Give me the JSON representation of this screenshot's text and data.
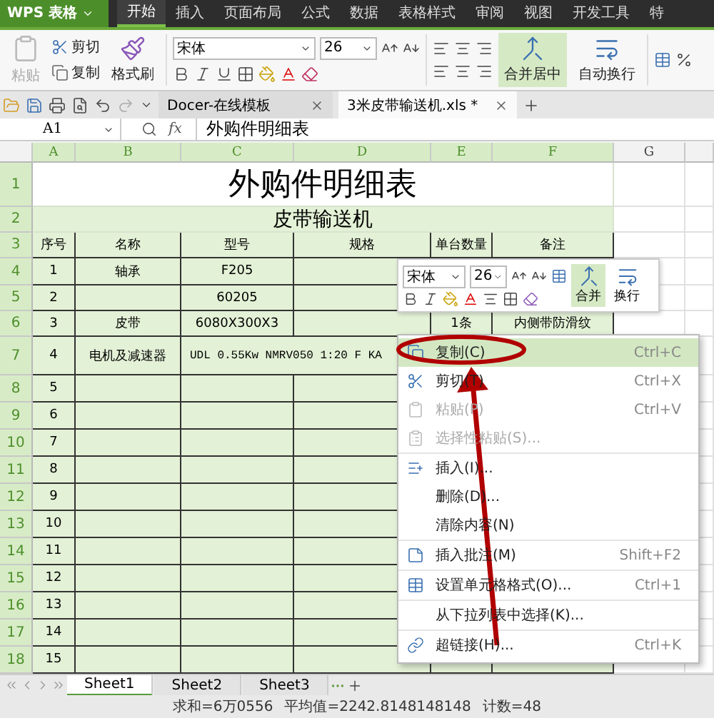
{
  "app": {
    "title": "WPS 表格"
  },
  "menu_tabs": [
    {
      "label": "开始",
      "selected": true
    },
    {
      "label": "插入",
      "selected": false
    },
    {
      "label": "页面布局",
      "selected": false
    },
    {
      "label": "公式",
      "selected": false
    },
    {
      "label": "数据",
      "selected": false
    },
    {
      "label": "表格样式",
      "selected": false
    },
    {
      "label": "审阅",
      "selected": false
    },
    {
      "label": "视图",
      "selected": false
    },
    {
      "label": "开发工具",
      "selected": false
    },
    {
      "label": "特",
      "selected": false
    }
  ],
  "ribbon": {
    "paste": {
      "label": "粘贴",
      "disabled": true
    },
    "cut": "剪切",
    "copy": "复制",
    "format_painter": "格式刷",
    "font": "宋体",
    "font_size": "26",
    "merge": {
      "label": "合并居中",
      "selected": true
    },
    "wrap": "自动换行"
  },
  "doc_tabs": [
    {
      "label": "Docer-在线模板",
      "selected": false
    },
    {
      "label": "3米皮带输送机.xls *",
      "selected": true
    }
  ],
  "formula_bar": {
    "name_box": "A1",
    "fx": "fx",
    "value": "外购件明细表"
  },
  "columns": [
    {
      "label": "A",
      "selected": true
    },
    {
      "label": "B",
      "selected": true
    },
    {
      "label": "C",
      "selected": true
    },
    {
      "label": "D",
      "selected": true
    },
    {
      "label": "E",
      "selected": true
    },
    {
      "label": "F",
      "selected": true
    },
    {
      "label": "G",
      "selected": false
    }
  ],
  "rows": [
    {
      "number": "1",
      "selected": true,
      "kind": "title",
      "cells": {
        "A": "外购件明细表"
      }
    },
    {
      "number": "2",
      "selected": true,
      "kind": "subtitle",
      "cells": {
        "A": "皮带输送机"
      }
    },
    {
      "number": "3",
      "selected": true,
      "kind": "data",
      "cells": {
        "A": "序号",
        "B": "名称",
        "C": "型号",
        "D": "规格",
        "E": "单台数量",
        "F": "备注"
      }
    },
    {
      "number": "4",
      "selected": true,
      "kind": "data",
      "cells": {
        "A": "1",
        "B": "轴承",
        "C": "F205"
      }
    },
    {
      "number": "5",
      "selected": true,
      "kind": "data",
      "cells": {
        "A": "2",
        "C": "60205"
      }
    },
    {
      "number": "6",
      "selected": true,
      "kind": "data",
      "cells": {
        "A": "3",
        "B": "皮带",
        "C": "6080X300X3",
        "E": "1条",
        "F": "内侧带防滑纹"
      }
    },
    {
      "number": "7",
      "selected": true,
      "kind": "merged",
      "cells": {
        "A": "4",
        "B": "电机及减速器",
        "C": "UDL 0.55Kw NMRV050 1:20 F KA"
      }
    },
    {
      "number": "8",
      "selected": true,
      "kind": "data",
      "cells": {
        "A": "5"
      }
    },
    {
      "number": "9",
      "selected": true,
      "kind": "data",
      "cells": {
        "A": "6"
      }
    },
    {
      "number": "10",
      "selected": true,
      "kind": "data",
      "cells": {
        "A": "7"
      }
    },
    {
      "number": "11",
      "selected": true,
      "kind": "data",
      "cells": {
        "A": "8"
      }
    },
    {
      "number": "12",
      "selected": true,
      "kind": "data",
      "cells": {
        "A": "9"
      }
    },
    {
      "number": "13",
      "selected": true,
      "kind": "data",
      "cells": {
        "A": "10"
      }
    },
    {
      "number": "14",
      "selected": true,
      "kind": "data",
      "cells": {
        "A": "11"
      }
    },
    {
      "number": "15",
      "selected": true,
      "kind": "data",
      "cells": {
        "A": "12"
      }
    },
    {
      "number": "16",
      "selected": true,
      "kind": "data",
      "cells": {
        "A": "13"
      }
    },
    {
      "number": "17",
      "selected": true,
      "kind": "data",
      "cells": {
        "A": "14"
      }
    },
    {
      "number": "18",
      "selected": true,
      "kind": "data",
      "cells": {
        "A": "15"
      }
    }
  ],
  "mini_toolbar": {
    "font": "宋体",
    "size": "26",
    "merge": "合并",
    "wrap": "换行"
  },
  "context_menu": [
    [
      {
        "label": "复制(C)",
        "shortcut": "Ctrl+C",
        "selected": true,
        "disabled": false
      },
      {
        "label": "剪切(T)",
        "shortcut": "Ctrl+X",
        "selected": false,
        "disabled": false
      },
      {
        "label": "粘贴(P)",
        "shortcut": "Ctrl+V",
        "selected": false,
        "disabled": true
      },
      {
        "label": "选择性粘贴(S)...",
        "selected": false,
        "disabled": true
      }
    ],
    [
      {
        "label": "插入(I)...",
        "selected": false,
        "disabled": false
      },
      {
        "label": "删除(D)...",
        "selected": false,
        "disabled": false
      },
      {
        "label": "清除内容(N)",
        "selected": false,
        "disabled": false
      }
    ],
    [
      {
        "label": "插入批注(M)",
        "shortcut": "Shift+F2",
        "selected": false,
        "disabled": false
      }
    ],
    [
      {
        "label": "设置单元格格式(O)...",
        "shortcut": "Ctrl+1",
        "selected": false,
        "disabled": false
      }
    ],
    [
      {
        "label": "从下拉列表中选择(K)...",
        "selected": false,
        "disabled": false
      }
    ],
    [
      {
        "label": "超链接(H)...",
        "shortcut": "Ctrl+K",
        "selected": false,
        "disabled": false
      }
    ]
  ],
  "sheet_tabs": [
    {
      "label": "Sheet1",
      "selected": true
    },
    {
      "label": "Sheet2",
      "selected": false
    },
    {
      "label": "Sheet3",
      "selected": false
    }
  ],
  "status_bar": {
    "sum": "求和=6万0556",
    "average": "平均值=2242.8148148148",
    "count": "计数=48"
  }
}
